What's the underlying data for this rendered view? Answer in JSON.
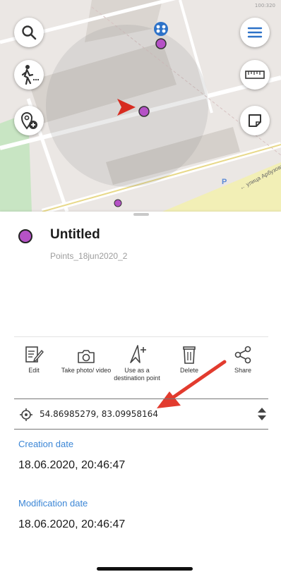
{
  "map": {
    "scale_text": "100:320",
    "street_label": "← улица Арбузова",
    "parking_label": "P",
    "buttons": {
      "search": "search-icon",
      "menu": "menu-icon",
      "walk": "walk-icon",
      "ruler": "ruler-icon",
      "add_place": "add-place-icon",
      "area": "area-icon"
    }
  },
  "point": {
    "title": "Untitled",
    "subtitle": "Points_18jun2020_2",
    "color": "#b552c6"
  },
  "actions": [
    {
      "label": "Edit",
      "icon": "edit-icon"
    },
    {
      "label": "Take photo/ video",
      "icon": "camera-icon"
    },
    {
      "label": "Use as a destination point",
      "icon": "navigate-icon"
    },
    {
      "label": "Delete",
      "icon": "trash-icon"
    },
    {
      "label": "Share",
      "icon": "share-icon"
    }
  ],
  "coordinates": {
    "value": "54.86985279, 83.09958164",
    "format_icon": "target-icon"
  },
  "creation": {
    "label": "Creation date",
    "value": "18.06.2020, 20:46:47"
  },
  "modification": {
    "label": "Modification date",
    "value": "18.06.2020, 20:46:47"
  },
  "colors": {
    "accent": "#3b86d6",
    "arrow": "#e23b2e",
    "marker": "#b552c6"
  }
}
